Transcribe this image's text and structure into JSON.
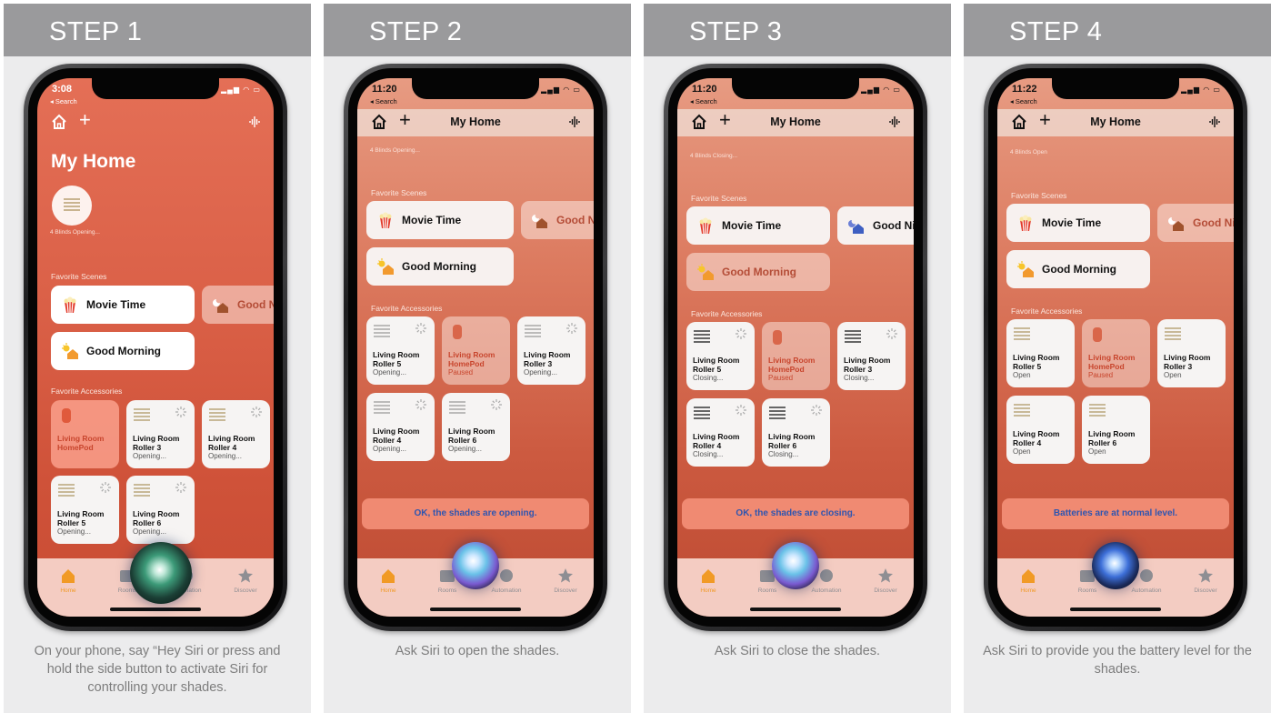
{
  "steps": [
    {
      "header": "STEP 1",
      "caption": "On your phone, say “Hey Siri or press and hold the side button to activate Siri for controlling your shades.",
      "status_time": "3:08",
      "status_back": "◂ Search",
      "nav_title": "",
      "page_title": "My Home",
      "blinds_label": "4 Blinds Opening...",
      "scenes_heading": "Favorite Scenes",
      "accessories_heading": "Favorite Accessories",
      "scenes": [
        "Movie Time",
        "Good Nig",
        "Good Morning"
      ],
      "tiles": [
        {
          "name": "Living Room HomePod",
          "status": ""
        },
        {
          "name": "Living Room Roller 3",
          "status": "Opening..."
        },
        {
          "name": "Living Room Roller 4",
          "status": "Opening..."
        },
        {
          "name": "Living Room Roller 5",
          "status": "Opening..."
        },
        {
          "name": "Living Room Roller 6",
          "status": "Opening..."
        }
      ],
      "toast": ""
    },
    {
      "header": "STEP 2",
      "caption": "Ask Siri to open the shades.",
      "status_time": "11:20",
      "status_back": "◂ Search",
      "nav_title": "My Home",
      "page_title": "",
      "blinds_label": "4 Blinds Opening...",
      "scenes_heading": "Favorite Scenes",
      "accessories_heading": "Favorite Accessories",
      "scenes": [
        "Movie Time",
        "Good Ni",
        "Good Morning"
      ],
      "tiles": [
        {
          "name": "Living Room Roller 5",
          "status": "Opening..."
        },
        {
          "name": "Living Room HomePod",
          "status": "Paused"
        },
        {
          "name": "Living Room Roller 3",
          "status": "Opening..."
        },
        {
          "name": "Living Room Roller 4",
          "status": "Opening..."
        },
        {
          "name": "Living Room Roller 6",
          "status": "Opening..."
        }
      ],
      "toast": "OK, the shades are opening."
    },
    {
      "header": "STEP 3",
      "caption": "Ask Siri to close the shades.",
      "status_time": "11:20",
      "status_back": "◂ Search",
      "nav_title": "My Home",
      "page_title": "",
      "blinds_label": "4 Blinds Closing...",
      "scenes_heading": "Favorite Scenes",
      "accessories_heading": "Favorite Accessories",
      "scenes": [
        "Movie Time",
        "Good Nig",
        "Good Morning"
      ],
      "tiles": [
        {
          "name": "Living Room Roller 5",
          "status": "Closing..."
        },
        {
          "name": "Living Room HomePod",
          "status": "Paused"
        },
        {
          "name": "Living Room Roller 3",
          "status": "Closing..."
        },
        {
          "name": "Living Room Roller 4",
          "status": "Closing..."
        },
        {
          "name": "Living Room Roller 6",
          "status": "Closing..."
        }
      ],
      "toast": "OK, the shades are closing."
    },
    {
      "header": "STEP 4",
      "caption": "Ask Siri to provide you the battery level for the shades.",
      "status_time": "11:22",
      "status_back": "◂ Search",
      "nav_title": "My Home",
      "page_title": "",
      "blinds_label": "4 Blinds Open",
      "scenes_heading": "Favorite Scenes",
      "accessories_heading": "Favorite Accessories",
      "scenes": [
        "Movie Time",
        "Good Ni",
        "Good Morning"
      ],
      "tiles": [
        {
          "name": "Living Room Roller 5",
          "status": "Open"
        },
        {
          "name": "Living Room HomePod",
          "status": "Paused"
        },
        {
          "name": "Living Room Roller 3",
          "status": "Open"
        },
        {
          "name": "Living Room Roller 4",
          "status": "Open"
        },
        {
          "name": "Living Room Roller 6",
          "status": "Open"
        }
      ],
      "toast": "Batteries are at normal level."
    }
  ],
  "tabbar": {
    "home": "Home",
    "rooms": "Rooms",
    "automation": "Automation",
    "discover": "Discover"
  },
  "colors": {
    "panel_header": "#9a9a9c",
    "panel_bg": "#ececed",
    "home_accent": "#f19a25",
    "toast_bg": "#f08a72",
    "toast_text": "#2e55b0",
    "homepod_accent": "#c8452d"
  },
  "icons": [
    "home-icon",
    "plus-icon",
    "siri-waveform-icon",
    "blinds-icon",
    "popcorn-icon",
    "sunrise-house-icon",
    "moon-house-icon",
    "homepod-icon",
    "spinner-icon",
    "rooms-icon",
    "automation-icon",
    "star-icon"
  ]
}
